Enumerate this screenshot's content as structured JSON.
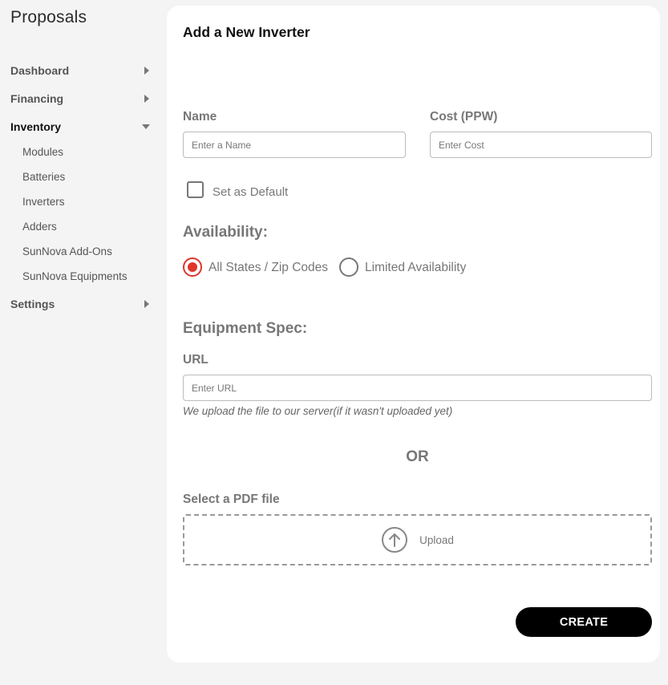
{
  "app": {
    "title": "Proposals"
  },
  "sidebar": {
    "items": [
      {
        "label": "Dashboard"
      },
      {
        "label": "Financing"
      },
      {
        "label": "Inventory"
      },
      {
        "label": "Settings"
      }
    ],
    "inventory_sub": [
      {
        "label": "Modules"
      },
      {
        "label": "Batteries"
      },
      {
        "label": "Inverters"
      },
      {
        "label": "Adders"
      },
      {
        "label": "SunNova Add-Ons"
      },
      {
        "label": "SunNova Equipments"
      }
    ]
  },
  "form": {
    "title": "Add a New Inverter",
    "name_label": "Name",
    "name_placeholder": "Enter a Name",
    "cost_label": "Cost (PPW)",
    "cost_placeholder": "Enter Cost",
    "default_label": "Set as Default",
    "availability_title": "Availability:",
    "availability_options": [
      {
        "label": "All States / Zip Codes",
        "selected": true
      },
      {
        "label": "Limited Availability",
        "selected": false
      }
    ],
    "spec_title": "Equipment Spec:",
    "url_label": "URL",
    "url_placeholder": "Enter URL",
    "url_helper": "We upload the file to our server(if it wasn't uploaded yet)",
    "or_text": "OR",
    "pdf_label": "Select a PDF file",
    "upload_label": "Upload",
    "create_label": "CREATE"
  },
  "colors": {
    "accent": "#e0352b",
    "button": "#000000",
    "background": "#f4f4f4"
  },
  "icons": {
    "dashboard": "caret-right-icon",
    "financing": "caret-right-icon",
    "inventory": "caret-down-icon",
    "settings": "caret-right-icon",
    "upload": "upload-arrow-circle-icon"
  }
}
